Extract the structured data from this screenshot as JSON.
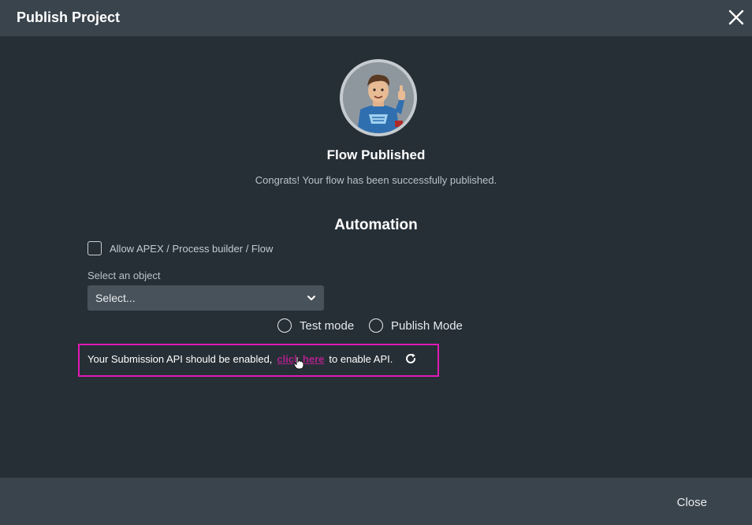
{
  "dialog": {
    "title": "Publish Project",
    "close_icon": "close-icon"
  },
  "status": {
    "avatar_icon": "superhero-mascot-avatar",
    "title": "Flow Published",
    "message": "Congrats! Your flow has been successfully published."
  },
  "automation": {
    "title": "Automation",
    "checkbox_label": "Allow APEX / Process builder / Flow",
    "checkbox_checked": false,
    "select_label": "Select an object",
    "select_value": "Select...",
    "radio_test_label": "Test mode",
    "radio_publish_label": "Publish Mode",
    "api_notice": {
      "before_link": "Your Submission API should be enabled,",
      "link": "click here",
      "after_link": "to enable API.",
      "refresh_icon": "refresh-icon",
      "highlight_color": "#e01ab5"
    }
  },
  "footer": {
    "close_label": "Close"
  }
}
